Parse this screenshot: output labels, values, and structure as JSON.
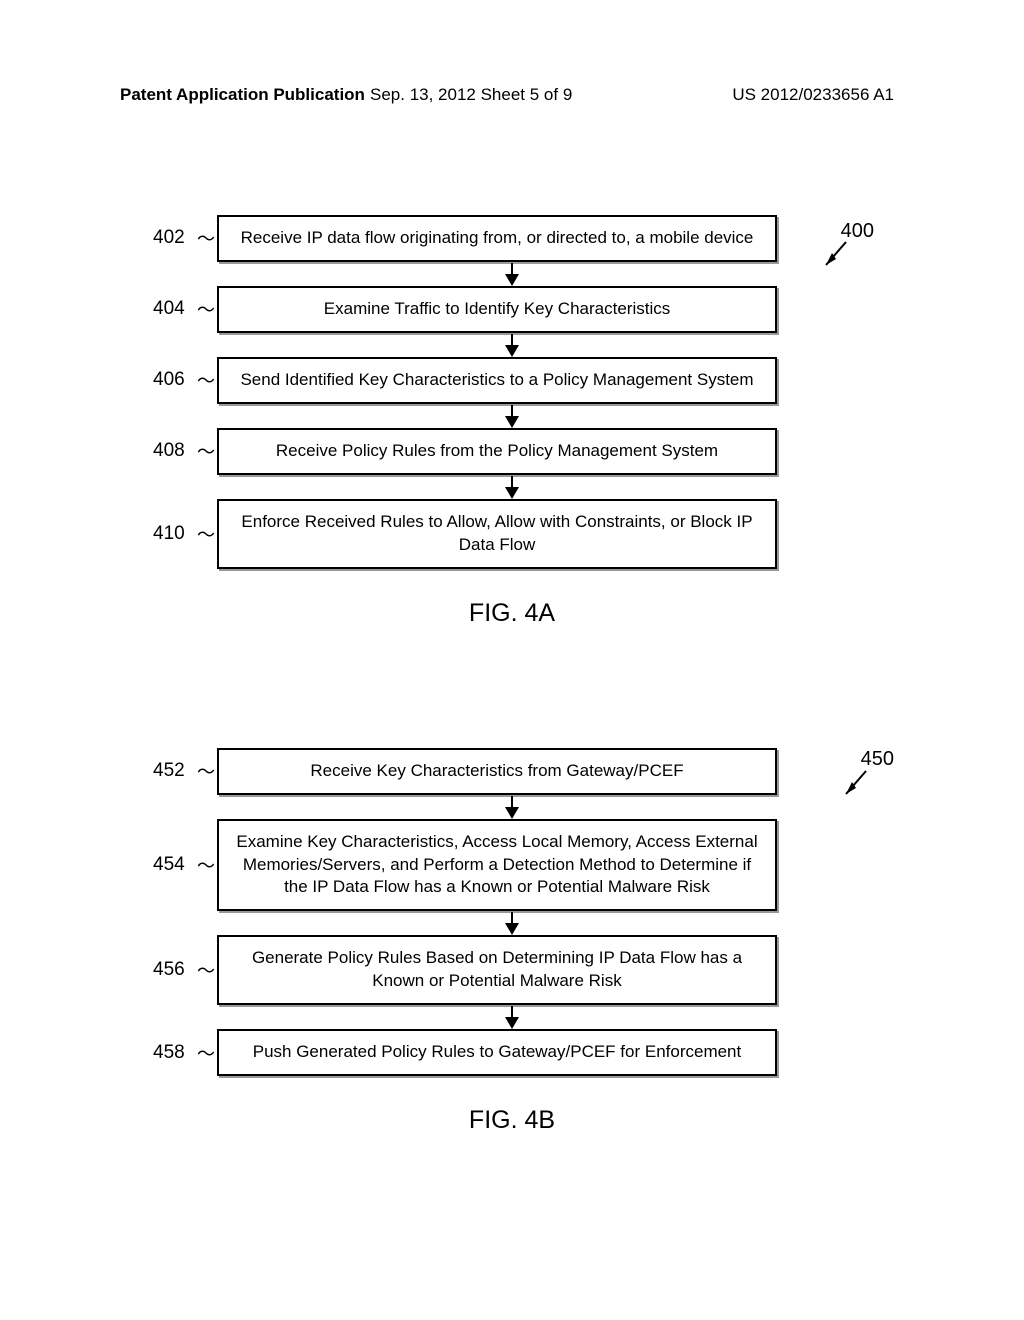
{
  "header": {
    "publication_label": "Patent Application Publication",
    "date_sheet": "Sep. 13, 2012   Sheet 5 of 9",
    "pub_number": "US 2012/0233656 A1"
  },
  "figureA": {
    "ref_number": "400",
    "title": "FIG. 4A",
    "steps": [
      {
        "num": "402",
        "text": "Receive IP data flow originating from, or directed to, a mobile device"
      },
      {
        "num": "404",
        "text": "Examine Traffic to Identify Key Characteristics"
      },
      {
        "num": "406",
        "text": "Send Identified Key Characteristics to a Policy Management System"
      },
      {
        "num": "408",
        "text": "Receive Policy Rules from the Policy Management System"
      },
      {
        "num": "410",
        "text": "Enforce Received Rules to Allow, Allow with Constraints, or Block IP Data Flow"
      }
    ]
  },
  "figureB": {
    "ref_number": "450",
    "title": "FIG. 4B",
    "steps": [
      {
        "num": "452",
        "text": "Receive Key Characteristics from Gateway/PCEF"
      },
      {
        "num": "454",
        "text": "Examine Key Characteristics, Access Local Memory, Access External Memories/Servers, and Perform a Detection Method to Determine if the IP Data Flow has a Known or Potential Malware Risk"
      },
      {
        "num": "456",
        "text": "Generate Policy Rules Based on Determining IP Data Flow has a Known or Potential Malware Risk"
      },
      {
        "num": "458",
        "text": "Push Generated Policy Rules to Gateway/PCEF for Enforcement"
      }
    ]
  }
}
